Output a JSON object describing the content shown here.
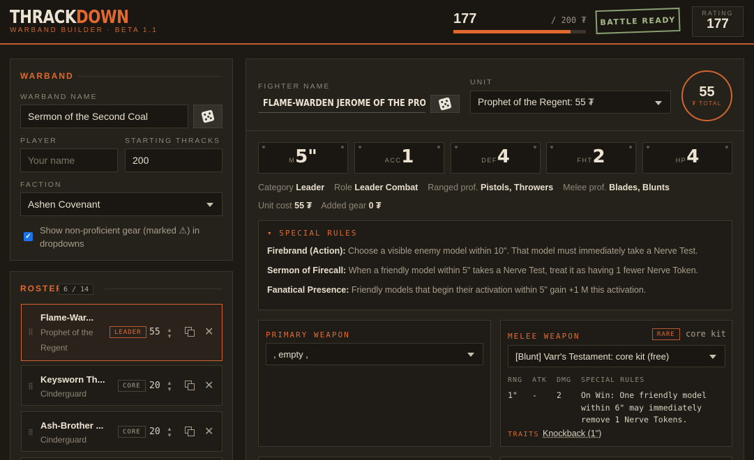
{
  "header": {
    "brand_a": "THRACK",
    "brand_b": "DOWN",
    "subtitle": "WARBAND BUILDER · BETA 1.1",
    "budget_used": "177",
    "budget_max": "/ 200 ₮",
    "budget_fraction": 0.885,
    "battle_ready": "BATTLE READY",
    "rating_label": "RATING",
    "rating_value": "177"
  },
  "warband": {
    "section_title": "WARBAND",
    "name_label": "WARBAND NAME",
    "name_value": "Sermon of the Second Coal",
    "player_label": "PLAYER",
    "player_placeholder": "Your name",
    "thracks_label": "STARTING THRACKS",
    "thracks_value": "200",
    "faction_label": "FACTION",
    "faction_value": "Ashen Covenant",
    "show_nonprof_label": "Show non-proficient gear (marked ⚠) in dropdowns",
    "show_nonprof_checked": true
  },
  "roster": {
    "section_title": "ROSTER",
    "count": "6 / 14",
    "items": [
      {
        "name": "Flame-War...",
        "unit": "Prophet of the Regent",
        "tag": "LEADER",
        "cost": "55"
      },
      {
        "name": "Keysworn Th...",
        "unit": "Cinderguard",
        "tag": "CORE",
        "cost": "20"
      },
      {
        "name": "Ash-Brother ...",
        "unit": "Cinderguard",
        "tag": "CORE",
        "cost": "20"
      }
    ]
  },
  "fighter": {
    "name_label": "FIGHTER NAME",
    "name_value": "FLAME-WARDEN JEROME OF THE PROMISE",
    "unit_label": "UNIT",
    "unit_value": "Prophet of the Regent: 55 ₮",
    "total_value": "55",
    "total_label": "₮ TOTAL",
    "stats": [
      {
        "label": "M",
        "value": "5\""
      },
      {
        "label": "ACC",
        "value": "1"
      },
      {
        "label": "DEF",
        "value": "4"
      },
      {
        "label": "FHT",
        "value": "2"
      },
      {
        "label": "HP",
        "value": "4"
      }
    ],
    "category_label": "Category",
    "category_value": "Leader",
    "role_label": "Role",
    "role_value": "Leader Combat",
    "ranged_label": "Ranged prof.",
    "ranged_value": "Pistols, Throwers",
    "melee_label": "Melee prof.",
    "melee_value": "Blades, Blunts",
    "unit_cost_label": "Unit cost",
    "unit_cost_value": "55 ₮",
    "added_gear_label": "Added gear",
    "added_gear_value": "0 ₮",
    "special_rules_title": "▾ SPECIAL RULES",
    "rules": [
      {
        "name": "Firebrand (Action):",
        "text": " Choose a visible enemy model within 10\". That model must immediately take a Nerve Test."
      },
      {
        "name": "Sermon of Firecall:",
        "text": " When a friendly model within 5\" takes a Nerve Test, treat it as having 1 fewer Nerve Token."
      },
      {
        "name": "Fanatical Presence:",
        "text": " Friendly models that begin their activation within 5\" gain +1 M this activation."
      }
    ]
  },
  "primary_weapon": {
    "title": "PRIMARY WEAPON",
    "value": ", empty ,"
  },
  "melee_weapon": {
    "title": "MELEE WEAPON",
    "rarity": "RARE",
    "kit": "core kit",
    "value": "[Blunt] Varr's Testament: core kit (free)",
    "headers": [
      "RNG",
      "ATK",
      "DMG",
      "SPECIAL RULES"
    ],
    "rng": "1\"",
    "atk": "-",
    "dmg": "2",
    "special_lines": [
      "On Win: One friendly model",
      "within 6\" may immediately",
      "remove 1 Nerve Tokens."
    ],
    "traits_label": "TRAITS",
    "traits_value": "Knockback (1\")"
  }
}
